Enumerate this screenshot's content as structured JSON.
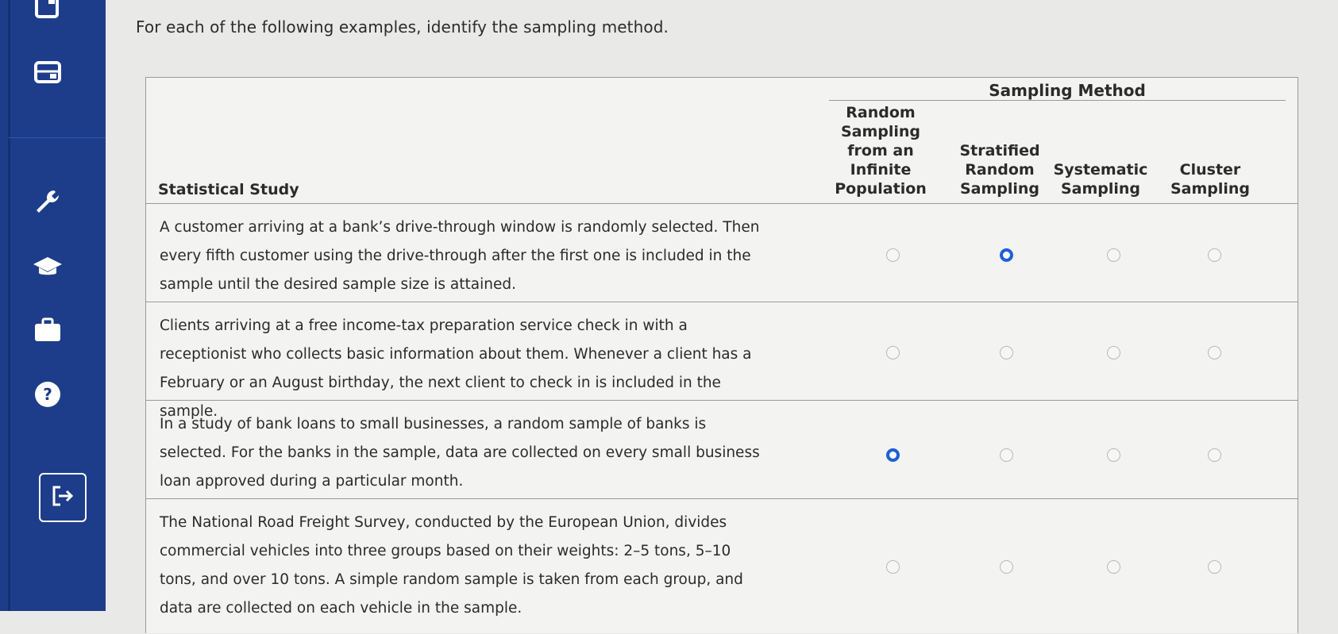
{
  "instructions": "For each of the following examples, identify the sampling method.",
  "table": {
    "group_header": "Sampling Method",
    "study_header": "Statistical Study",
    "columns": [
      "Random Sampling from an Infinite Population",
      "Stratified Random Sampling",
      "Systematic Sampling",
      "Cluster Sampling"
    ],
    "rows": [
      {
        "text": "A customer arriving at a bank’s drive-through window is randomly selected. Then every fifth customer using the drive-through after the first one is included in the sample until the desired sample size is attained.",
        "selected": "Stratified Random Sampling"
      },
      {
        "text": "Clients arriving at a free income-tax preparation service check in with a receptionist who collects basic information about them. Whenever a client has a February or an August birthday, the next client to check in is included in the sample.",
        "selected": ""
      },
      {
        "text": "In a study of bank loans to small businesses, a random sample of banks is selected. For the banks in the sample, data are collected on every small business loan approved during a particular month.",
        "selected": "Random Sampling from an Infinite Population"
      },
      {
        "text": "The National Road Freight Survey, conducted by the European Union, divides commercial vehicles into three groups based on their weights: 2–5 tons, 5–10 tons, and over 10 tons. A simple random sample is taken from each group, and data are collected on each vehicle in the sample.",
        "selected": ""
      }
    ]
  },
  "sidebar_icons": [
    "book-icon",
    "card-icon",
    "wrench-icon",
    "graduation-cap-icon",
    "briefcase-icon",
    "help-icon",
    "exit-icon"
  ],
  "colors": {
    "sidebar": "#1d3d8a",
    "radio_checked": "#1f5fd6",
    "page_bg": "#e9e9e7"
  }
}
